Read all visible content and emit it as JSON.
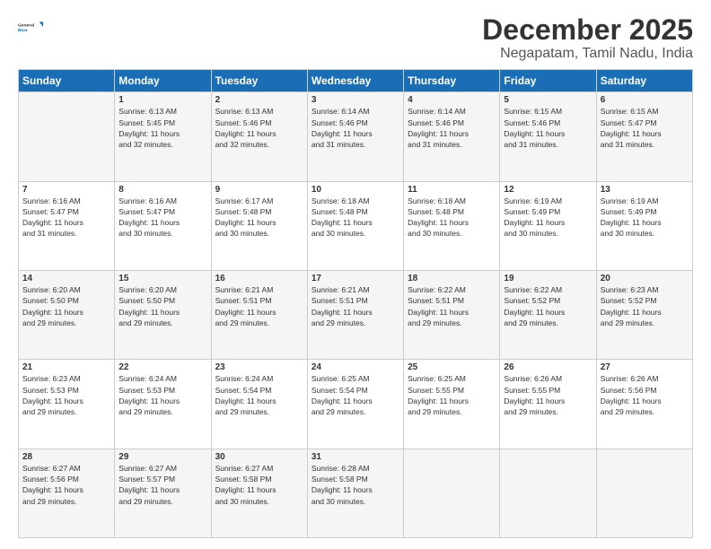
{
  "header": {
    "logo_general": "General",
    "logo_blue": "Blue",
    "month": "December 2025",
    "location": "Negapatam, Tamil Nadu, India"
  },
  "days_of_week": [
    "Sunday",
    "Monday",
    "Tuesday",
    "Wednesday",
    "Thursday",
    "Friday",
    "Saturday"
  ],
  "weeks": [
    [
      {
        "day": "",
        "info": ""
      },
      {
        "day": "1",
        "info": "Sunrise: 6:13 AM\nSunset: 5:45 PM\nDaylight: 11 hours\nand 32 minutes."
      },
      {
        "day": "2",
        "info": "Sunrise: 6:13 AM\nSunset: 5:46 PM\nDaylight: 11 hours\nand 32 minutes."
      },
      {
        "day": "3",
        "info": "Sunrise: 6:14 AM\nSunset: 5:46 PM\nDaylight: 11 hours\nand 31 minutes."
      },
      {
        "day": "4",
        "info": "Sunrise: 6:14 AM\nSunset: 5:46 PM\nDaylight: 11 hours\nand 31 minutes."
      },
      {
        "day": "5",
        "info": "Sunrise: 6:15 AM\nSunset: 5:46 PM\nDaylight: 11 hours\nand 31 minutes."
      },
      {
        "day": "6",
        "info": "Sunrise: 6:15 AM\nSunset: 5:47 PM\nDaylight: 11 hours\nand 31 minutes."
      }
    ],
    [
      {
        "day": "7",
        "info": "Sunrise: 6:16 AM\nSunset: 5:47 PM\nDaylight: 11 hours\nand 31 minutes."
      },
      {
        "day": "8",
        "info": "Sunrise: 6:16 AM\nSunset: 5:47 PM\nDaylight: 11 hours\nand 30 minutes."
      },
      {
        "day": "9",
        "info": "Sunrise: 6:17 AM\nSunset: 5:48 PM\nDaylight: 11 hours\nand 30 minutes."
      },
      {
        "day": "10",
        "info": "Sunrise: 6:18 AM\nSunset: 5:48 PM\nDaylight: 11 hours\nand 30 minutes."
      },
      {
        "day": "11",
        "info": "Sunrise: 6:18 AM\nSunset: 5:48 PM\nDaylight: 11 hours\nand 30 minutes."
      },
      {
        "day": "12",
        "info": "Sunrise: 6:19 AM\nSunset: 5:49 PM\nDaylight: 11 hours\nand 30 minutes."
      },
      {
        "day": "13",
        "info": "Sunrise: 6:19 AM\nSunset: 5:49 PM\nDaylight: 11 hours\nand 30 minutes."
      }
    ],
    [
      {
        "day": "14",
        "info": "Sunrise: 6:20 AM\nSunset: 5:50 PM\nDaylight: 11 hours\nand 29 minutes."
      },
      {
        "day": "15",
        "info": "Sunrise: 6:20 AM\nSunset: 5:50 PM\nDaylight: 11 hours\nand 29 minutes."
      },
      {
        "day": "16",
        "info": "Sunrise: 6:21 AM\nSunset: 5:51 PM\nDaylight: 11 hours\nand 29 minutes."
      },
      {
        "day": "17",
        "info": "Sunrise: 6:21 AM\nSunset: 5:51 PM\nDaylight: 11 hours\nand 29 minutes."
      },
      {
        "day": "18",
        "info": "Sunrise: 6:22 AM\nSunset: 5:51 PM\nDaylight: 11 hours\nand 29 minutes."
      },
      {
        "day": "19",
        "info": "Sunrise: 6:22 AM\nSunset: 5:52 PM\nDaylight: 11 hours\nand 29 minutes."
      },
      {
        "day": "20",
        "info": "Sunrise: 6:23 AM\nSunset: 5:52 PM\nDaylight: 11 hours\nand 29 minutes."
      }
    ],
    [
      {
        "day": "21",
        "info": "Sunrise: 6:23 AM\nSunset: 5:53 PM\nDaylight: 11 hours\nand 29 minutes."
      },
      {
        "day": "22",
        "info": "Sunrise: 6:24 AM\nSunset: 5:53 PM\nDaylight: 11 hours\nand 29 minutes."
      },
      {
        "day": "23",
        "info": "Sunrise: 6:24 AM\nSunset: 5:54 PM\nDaylight: 11 hours\nand 29 minutes."
      },
      {
        "day": "24",
        "info": "Sunrise: 6:25 AM\nSunset: 5:54 PM\nDaylight: 11 hours\nand 29 minutes."
      },
      {
        "day": "25",
        "info": "Sunrise: 6:25 AM\nSunset: 5:55 PM\nDaylight: 11 hours\nand 29 minutes."
      },
      {
        "day": "26",
        "info": "Sunrise: 6:26 AM\nSunset: 5:55 PM\nDaylight: 11 hours\nand 29 minutes."
      },
      {
        "day": "27",
        "info": "Sunrise: 6:26 AM\nSunset: 5:56 PM\nDaylight: 11 hours\nand 29 minutes."
      }
    ],
    [
      {
        "day": "28",
        "info": "Sunrise: 6:27 AM\nSunset: 5:56 PM\nDaylight: 11 hours\nand 29 minutes."
      },
      {
        "day": "29",
        "info": "Sunrise: 6:27 AM\nSunset: 5:57 PM\nDaylight: 11 hours\nand 29 minutes."
      },
      {
        "day": "30",
        "info": "Sunrise: 6:27 AM\nSunset: 5:58 PM\nDaylight: 11 hours\nand 30 minutes."
      },
      {
        "day": "31",
        "info": "Sunrise: 6:28 AM\nSunset: 5:58 PM\nDaylight: 11 hours\nand 30 minutes."
      },
      {
        "day": "",
        "info": ""
      },
      {
        "day": "",
        "info": ""
      },
      {
        "day": "",
        "info": ""
      }
    ]
  ]
}
